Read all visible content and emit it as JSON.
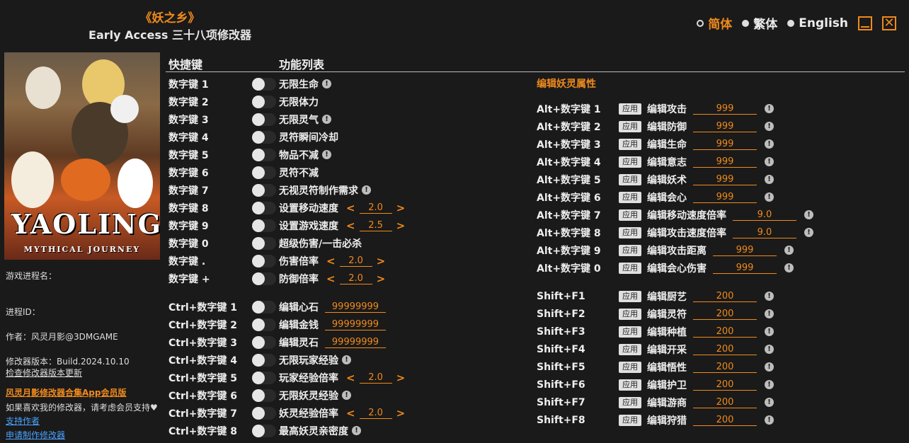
{
  "header": {
    "game_title": "《妖之乡》",
    "subtitle": "Early Access 三十八项修改器"
  },
  "languages": [
    {
      "label": "简体",
      "active": true
    },
    {
      "label": "繁体",
      "active": false
    },
    {
      "label": "English",
      "active": false
    }
  ],
  "cover": {
    "logo_text": "YAOLING",
    "logo_sub": "MYTHICAL JOURNEY"
  },
  "info": {
    "process_name": "游戏进程名：",
    "process_id": "进程ID：",
    "author": "作者：风灵月影@3DMGAME",
    "version": "修改器版本：Build.2024.10.10",
    "check_update": "检查修改器版本更新",
    "app_promo": "风灵月影修改器合集App会员版",
    "support_text": "如果喜欢我的修改器，请考虑会员支持♥",
    "support_link": "支持作者",
    "request_link": "申请制作修改器"
  },
  "columns": {
    "hotkey": "快捷键",
    "features": "功能列表"
  },
  "section_right": "编辑妖灵属性",
  "apply_label": "应用",
  "warn_mark": "!",
  "left_rows": [
    {
      "key": "数字键 1",
      "name": "无限生命",
      "warn": true
    },
    {
      "key": "数字键 2",
      "name": "无限体力",
      "warn": false
    },
    {
      "key": "数字键 3",
      "name": "无限灵气",
      "warn": true
    },
    {
      "key": "数字键 4",
      "name": "灵符瞬间冷却",
      "warn": false
    },
    {
      "key": "数字键 5",
      "name": "物品不减",
      "warn": true
    },
    {
      "key": "数字键 6",
      "name": "灵符不减",
      "warn": false
    },
    {
      "key": "数字键 7",
      "name": "无视灵符制作需求",
      "warn": true
    },
    {
      "key": "数字键 8",
      "name": "设置移动速度",
      "stepper": "2.0"
    },
    {
      "key": "数字键 9",
      "name": "设置游戏速度",
      "stepper": "2.5"
    },
    {
      "key": "数字键 0",
      "name": "超级伤害/一击必杀",
      "warn": false
    },
    {
      "key": "数字键 .",
      "name": "伤害倍率",
      "stepper": "2.0"
    },
    {
      "key": "数字键 +",
      "name": "防御倍率",
      "stepper": "2.0"
    }
  ],
  "ctrl_rows": [
    {
      "key": "Ctrl+数字键 1",
      "name": "编辑心石",
      "input": "99999999"
    },
    {
      "key": "Ctrl+数字键 2",
      "name": "编辑金钱",
      "input": "99999999"
    },
    {
      "key": "Ctrl+数字键 3",
      "name": "编辑灵石",
      "input": "99999999"
    },
    {
      "key": "Ctrl+数字键 4",
      "name": "无限玩家经验",
      "warn": true
    },
    {
      "key": "Ctrl+数字键 5",
      "name": "玩家经验倍率",
      "stepper": "2.0"
    },
    {
      "key": "Ctrl+数字键 6",
      "name": "无限妖灵经验",
      "warn": true
    },
    {
      "key": "Ctrl+数字键 7",
      "name": "妖灵经验倍率",
      "stepper": "2.0"
    },
    {
      "key": "Ctrl+数字键 8",
      "name": "最高妖灵亲密度",
      "warn": true
    }
  ],
  "alt_rows": [
    {
      "key": "Alt+数字键 1",
      "name": "编辑攻击",
      "value": "999"
    },
    {
      "key": "Alt+数字键 2",
      "name": "编辑防御",
      "value": "999"
    },
    {
      "key": "Alt+数字键 3",
      "name": "编辑生命",
      "value": "999"
    },
    {
      "key": "Alt+数字键 4",
      "name": "编辑意志",
      "value": "999"
    },
    {
      "key": "Alt+数字键 5",
      "name": "编辑妖术",
      "value": "999"
    },
    {
      "key": "Alt+数字键 6",
      "name": "编辑会心",
      "value": "999"
    },
    {
      "key": "Alt+数字键 7",
      "name": "编辑移动速度倍率",
      "value": "9.0"
    },
    {
      "key": "Alt+数字键 8",
      "name": "编辑攻击速度倍率",
      "value": "9.0"
    },
    {
      "key": "Alt+数字键 9",
      "name": "编辑攻击距离",
      "value": "999"
    },
    {
      "key": "Alt+数字键 0",
      "name": "编辑会心伤害",
      "value": "999"
    }
  ],
  "shift_rows": [
    {
      "key": "Shift+F1",
      "name": "编辑厨艺",
      "value": "200"
    },
    {
      "key": "Shift+F2",
      "name": "编辑灵符",
      "value": "200"
    },
    {
      "key": "Shift+F3",
      "name": "编辑种植",
      "value": "200"
    },
    {
      "key": "Shift+F4",
      "name": "编辑开采",
      "value": "200"
    },
    {
      "key": "Shift+F5",
      "name": "编辑悟性",
      "value": "200"
    },
    {
      "key": "Shift+F6",
      "name": "编辑护卫",
      "value": "200"
    },
    {
      "key": "Shift+F7",
      "name": "编辑游商",
      "value": "200"
    },
    {
      "key": "Shift+F8",
      "name": "编辑狩猎",
      "value": "200"
    }
  ],
  "colors": {
    "accent": "#f08a1c",
    "background": "#1a1a1a",
    "link": "#4aa3ff"
  }
}
